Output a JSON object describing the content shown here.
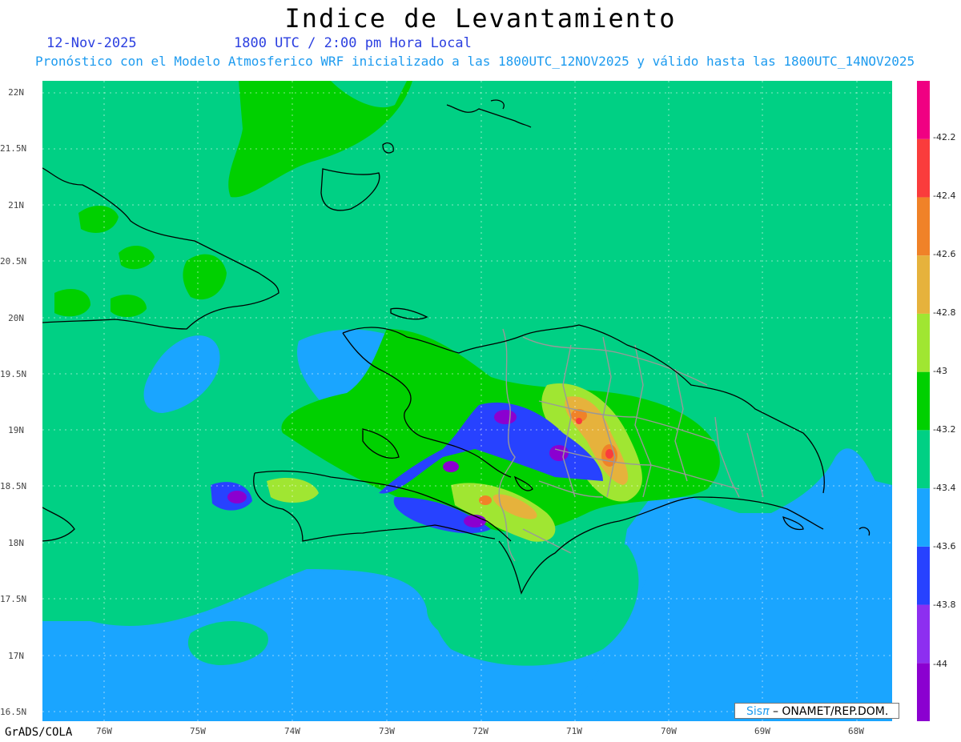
{
  "title": "Indice de Levantamiento",
  "date": "12-Nov-2025",
  "time": "1800 UTC / 2:00 pm Hora Local",
  "forecast": "Pronóstico con el Modelo Atmosferico WRF inicializado a las 1800UTC_12NOV2025 y válido hasta las  1800UTC_14NOV2025",
  "footer": {
    "software": "GrADS/COLA",
    "credit_brand": "Sis",
    "credit_pi": "π",
    "credit_org": " – ONAMET/REP.DOM."
  },
  "axes": {
    "lat_labels": [
      "22N",
      "21.5N",
      "21N",
      "20.5N",
      "20N",
      "19.5N",
      "19N",
      "18.5N",
      "18N",
      "17.5N",
      "17N",
      "16.5N"
    ],
    "lon_labels": [
      "76W",
      "75W",
      "74W",
      "73W",
      "72W",
      "71W",
      "70W",
      "69W",
      "68W"
    ]
  },
  "colorbar": {
    "labels": [
      "-42.2",
      "-42.4",
      "-42.6",
      "-42.8",
      "-43",
      "-43.2",
      "-43.4",
      "-43.6",
      "-43.8",
      "-44"
    ],
    "colors": [
      "#8b00d0",
      "#8d2ff0",
      "#2742ff",
      "#1aa5ff",
      "#00d084",
      "#00d000",
      "#a0e632",
      "#e6b23c",
      "#f08228",
      "#fa3c3c",
      "#f00082"
    ]
  },
  "map_colors": {
    "sea": "#1aa5ff",
    "main": "#00d084",
    "green": "#00d000",
    "lime": "#a0e632",
    "blue": "#2742ff",
    "violet": "#8b00d0",
    "orange": "#e6b23c",
    "deep_orange": "#f08228",
    "red": "#fa3c3c",
    "coast": "#000000",
    "borders": "#999999"
  }
}
